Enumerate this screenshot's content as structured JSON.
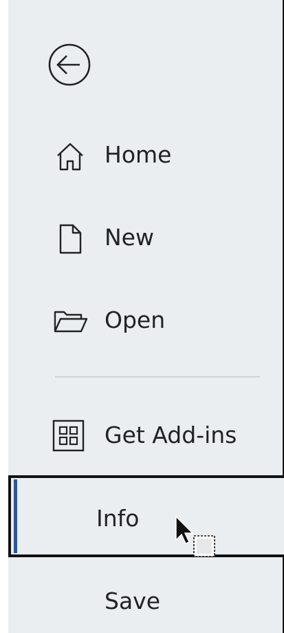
{
  "nav": {
    "back_icon": "back-arrow-circle-icon",
    "items": [
      {
        "label": "Home",
        "icon": "home-icon"
      },
      {
        "label": "New",
        "icon": "new-document-icon"
      },
      {
        "label": "Open",
        "icon": "open-folder-icon"
      },
      {
        "label": "Get Add-ins",
        "icon": "add-ins-grid-icon"
      },
      {
        "label": "Info",
        "icon": "",
        "selected": true
      },
      {
        "label": "Save",
        "icon": ""
      }
    ]
  },
  "colors": {
    "nav_background": "#eaeef1",
    "accent": "#2b5797",
    "text": "#222222",
    "divider": "#cfd3d7"
  }
}
